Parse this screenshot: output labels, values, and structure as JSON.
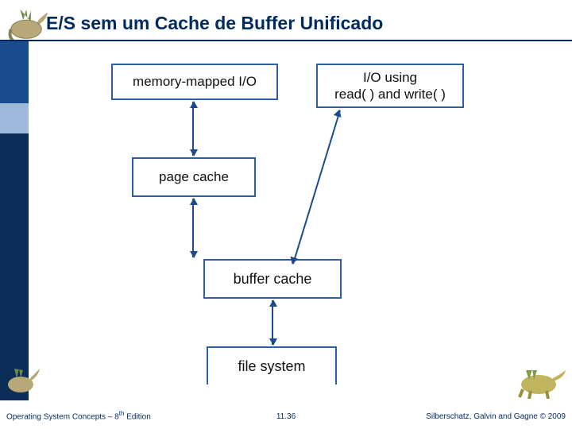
{
  "title": "E/S sem um Cache de Buffer Unificado",
  "boxes": {
    "mmio": "memory-mapped I/O",
    "iorw": "I/O using\nread( ) and write( )",
    "page_cache": "page cache",
    "buffer_cache": "buffer cache",
    "file_system": "file system"
  },
  "footer": {
    "left_prefix": "Operating System Concepts – 8",
    "left_sup": "th",
    "left_suffix": " Edition",
    "center": "11.36",
    "right": "Silberschatz, Galvin and Gagne © 2009"
  },
  "chart_data": {
    "type": "diagram",
    "title": "E/S sem um Cache de Buffer Unificado",
    "nodes": [
      {
        "id": "mmio",
        "label": "memory-mapped I/O"
      },
      {
        "id": "iorw",
        "label": "I/O using read( ) and write( )"
      },
      {
        "id": "page",
        "label": "page cache"
      },
      {
        "id": "buffer",
        "label": "buffer cache"
      },
      {
        "id": "file",
        "label": "file system"
      }
    ],
    "edges": [
      {
        "from": "mmio",
        "to": "page",
        "bidirectional": true
      },
      {
        "from": "page",
        "to": "buffer",
        "bidirectional": true
      },
      {
        "from": "iorw",
        "to": "buffer",
        "bidirectional": true
      },
      {
        "from": "buffer",
        "to": "file",
        "bidirectional": true
      }
    ]
  }
}
